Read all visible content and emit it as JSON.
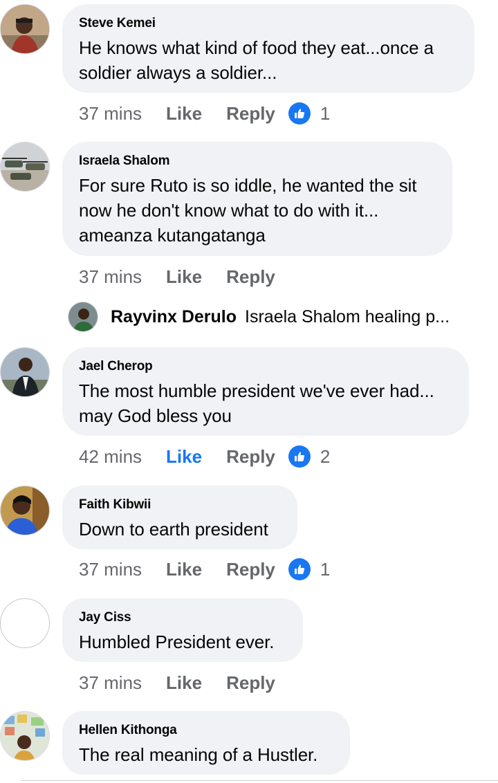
{
  "comments": [
    {
      "author": "Steve Kemei",
      "lines": [
        "He knows what kind of food they eat...once a",
        "soldier always a soldier..."
      ],
      "time": "37 mins",
      "like_label": "Like",
      "reply_label": "Reply",
      "reactions": "1"
    },
    {
      "author": "Israela Shalom",
      "lines": [
        "For sure Ruto is so iddle, he wanted the sit",
        "now he don't know what to do with it...",
        "ameanza kutangatanga"
      ],
      "time": "37 mins",
      "like_label": "Like",
      "reply_label": "Reply"
    },
    {
      "author": "Jael Cherop",
      "lines": [
        "The most humble president we've ever had...",
        "may God bless you"
      ],
      "time": "42 mins",
      "like_label": "Like",
      "reply_label": "Reply",
      "reactions": "2",
      "liked": true
    },
    {
      "author": "Faith Kibwii",
      "lines": [
        "Down to earth president"
      ],
      "time": "37 mins",
      "like_label": "Like",
      "reply_label": "Reply",
      "reactions": "1"
    },
    {
      "author": "Jay Ciss",
      "lines": [
        "Humbled President ever."
      ],
      "time": "37 mins",
      "like_label": "Like",
      "reply_label": "Reply"
    },
    {
      "author": "Hellen Kithonga",
      "lines": [
        "The real meaning of a Hustler."
      ]
    }
  ],
  "reply_preview": {
    "author": "Rayvinx Derulo",
    "text": "Israela Shalom healing p..."
  },
  "colors": {
    "bubble": "#f0f2f5",
    "secondary_text": "#65676b",
    "accent": "#1877f2",
    "primary_text": "#050505"
  },
  "icons": {
    "reaction": "thumbs-up-icon"
  }
}
